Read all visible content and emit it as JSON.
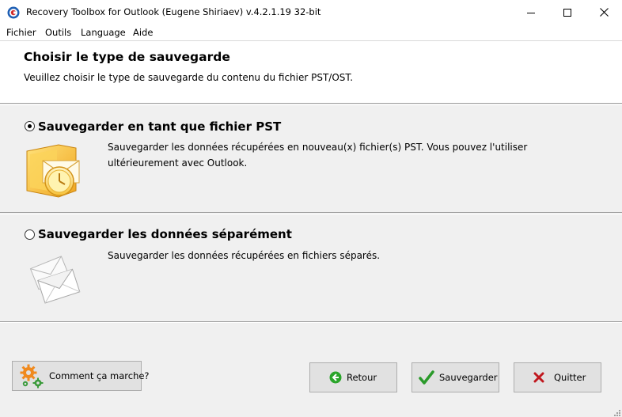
{
  "window": {
    "title": "Recovery Toolbox for Outlook (Eugene Shiriaev) v.4.2.1.19 32-bit"
  },
  "menu": [
    "Fichier",
    "Outils",
    "Language",
    "Aide"
  ],
  "header": {
    "title": "Choisir le type de sauvegarde",
    "subtitle": "Veuillez choisir le type de sauvegarde du contenu du fichier PST/OST."
  },
  "options": [
    {
      "title": "Sauvegarder en tant que fichier PST",
      "description": "Sauvegarder les données récupérées en nouveau(x) fichier(s) PST.  Vous pouvez l'utiliser ultérieurement avec Outlook.",
      "selected": true,
      "icon": "outlook-icon"
    },
    {
      "title": "Sauvegarder les données séparément",
      "description": "Sauvegarder les données récupérées en fichiers séparés.",
      "selected": false,
      "icon": "envelopes-icon"
    }
  ],
  "buttons": {
    "help": "Comment ça marche?",
    "back": "Retour",
    "save": "Sauvegarder",
    "quit": "Quitter"
  },
  "colors": {
    "back_icon": "#2aa52a",
    "save_icon": "#2a9a2a",
    "quit_icon": "#c0181e",
    "gear_orange": "#f08a1e",
    "gear_green": "#3a9a3a"
  }
}
